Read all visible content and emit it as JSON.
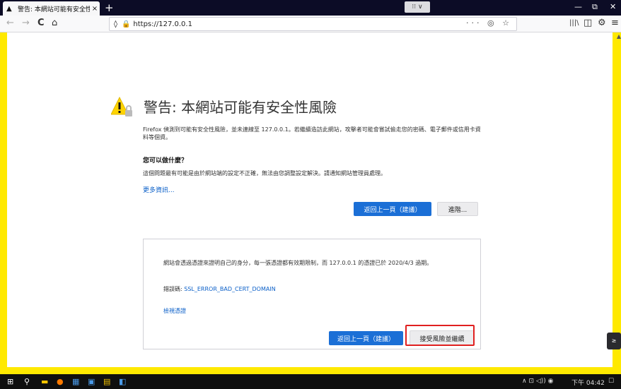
{
  "tab": {
    "title": "警告: 本網站可能有安全性風險",
    "close": "×"
  },
  "newtab": "+",
  "drag_handle": "⁝⁝ ∨",
  "window": {
    "min": "—",
    "max": "⧉",
    "close": "✕"
  },
  "nav": {
    "back": "←",
    "forward": "→",
    "reload": "C",
    "home": "⌂",
    "library": "|||\\",
    "sidebar": "◫",
    "ext": "⚙",
    "menu": "≡"
  },
  "url": {
    "value": "https://127.0.0.1",
    "shield": "◊",
    "lock": "🔒",
    "page_actions": "··· ◎ ☆"
  },
  "warning": {
    "title": "警告: 本網站可能有安全性風險",
    "description": "Firefox 偵測到可能有安全性風險，並未連線至 127.0.0.1。若繼續造訪此網站，攻擊者可能會嘗試偷走您的密碼、電子郵件或信用卡資料等個資。",
    "what_heading": "您可以做什麼？",
    "what_text": "這個問題最有可能是由於網站端的設定不正確，無法由您調整設定解決。請通知網站管理員處理。",
    "learn_more": "更多資訊...",
    "go_back_button": "返回上一頁（建議）",
    "advanced_button": "進階..."
  },
  "advanced": {
    "text": "網站會透過憑證來證明自己的身分，每一張憑證都有效期限制，而 127.0.0.1 的憑證已於 2020/4/3 過期。",
    "error_code_label": "錯誤碼: ",
    "error_code": "SSL_ERROR_BAD_CERT_DOMAIN",
    "view_cert": "檢視憑證",
    "go_back_button": "返回上一頁（建議）",
    "accept_button": "接受風險並繼續"
  },
  "taskbar": {
    "start": "⊞",
    "search": "⚲",
    "apps": [
      "▬",
      "●",
      "▦",
      "▣",
      "▤",
      "◧"
    ],
    "tray_icons": "∧ ⊡ ◁)) ◉",
    "time": "下午 04:42",
    "notify": "☐"
  },
  "side_widget": "≥",
  "colors": {
    "accent": "#1b6fd6",
    "warning_border": "#ffe900",
    "highlight": "#e02020"
  }
}
